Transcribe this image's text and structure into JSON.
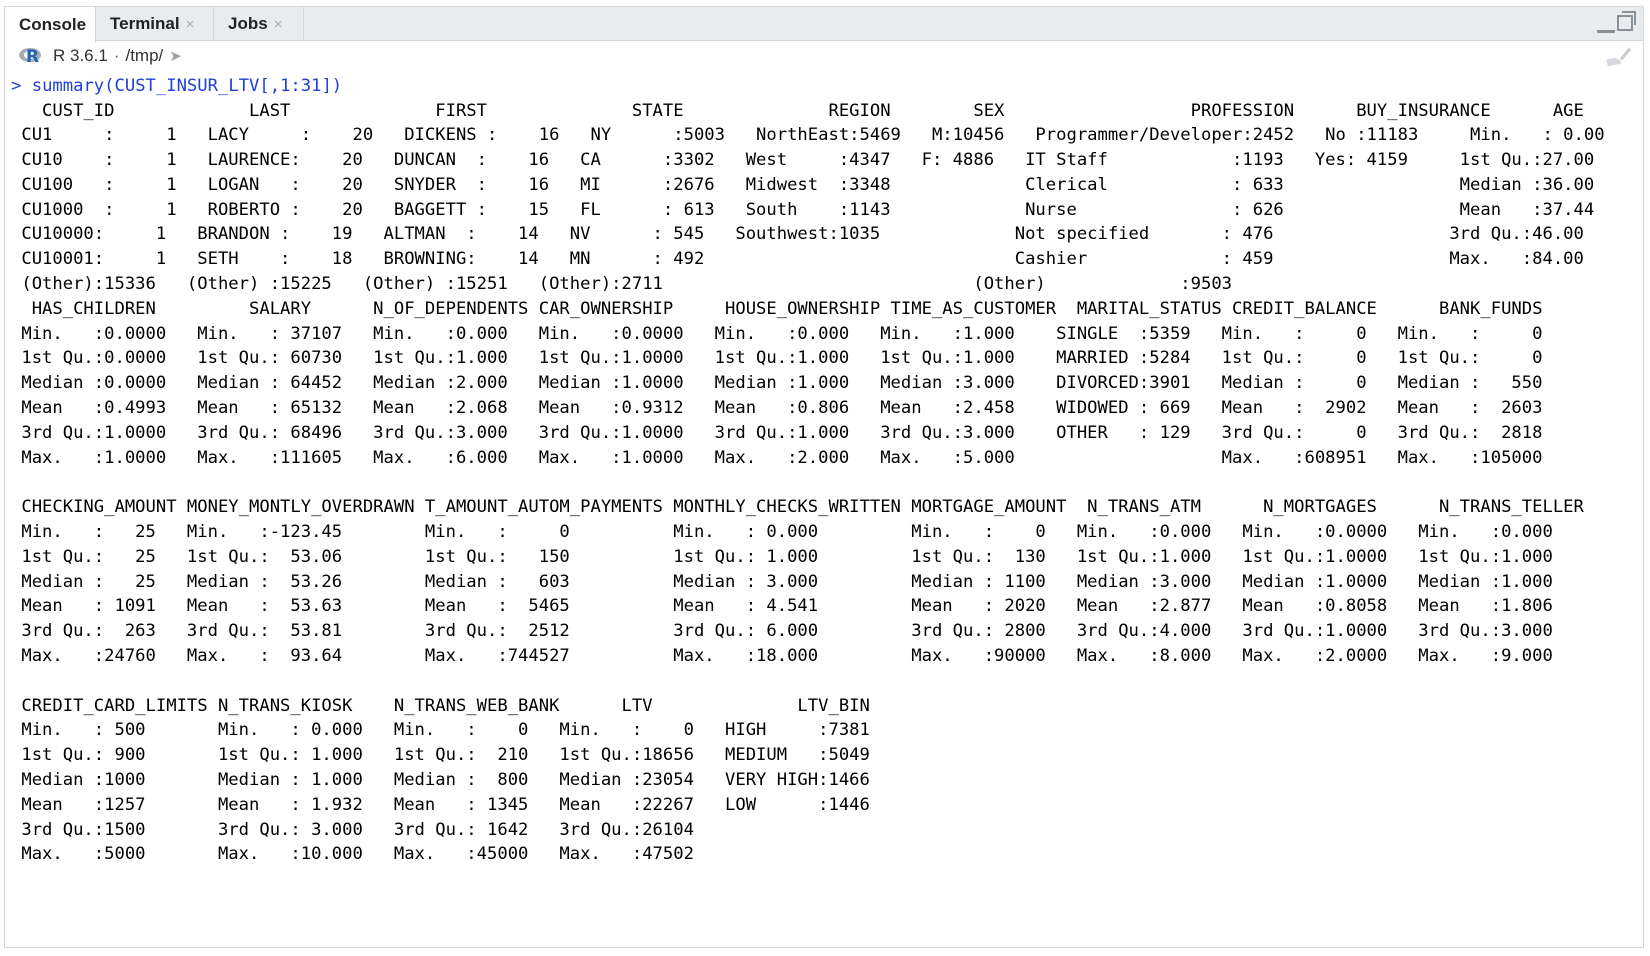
{
  "tabs": [
    {
      "label": "Console",
      "closable": false
    },
    {
      "label": "Terminal",
      "closable": true
    },
    {
      "label": "Jobs",
      "closable": true
    }
  ],
  "close_glyph": "×",
  "header": {
    "r_version": "R 3.6.1",
    "separator": "·",
    "path": "/tmp/"
  },
  "icons": {
    "r_logo": "r-logo-icon",
    "goto": "goto-directory-icon",
    "clear": "broom-icon",
    "minimize": "minimize-icon",
    "maximize": "maximize-icon"
  },
  "console": {
    "prompt": ">",
    "command": "summary(CUST_INSUR_LTV[,1:31])",
    "prompt_color": "#1f3fd6",
    "output": "   CUST_ID             LAST              FIRST              STATE              REGION        SEX                  PROFESSION      BUY_INSURANCE      AGE       \n CU1     :     1   LACY     :    20   DICKENS :    16   NY      :5003   NorthEast:5469   M:10456   Programmer/Developer:2452   No :11183     Min.   : 0.00  \n CU10    :     1   LAURENCE:    20   DUNCAN  :    16   CA      :3302   West     :4347   F: 4886   IT Staff            :1193   Yes: 4159     1st Qu.:27.00  \n CU100   :     1   LOGAN   :    20   SNYDER  :    16   MI      :2676   Midwest  :3348             Clerical            : 633                 Median :36.00  \n CU1000  :     1   ROBERTO :    20   BAGGETT :    15   FL      : 613   South    :1143             Nurse               : 626                 Mean   :37.44  \n CU10000:     1   BRANDON :    19   ALTMAN  :    14   NV      : 545   Southwest:1035             Not specified       : 476                 3rd Qu.:46.00  \n CU10001:     1   SETH    :    18   BROWNING:    14   MN      : 492                              Cashier             : 459                 Max.   :84.00  \n (Other):15336   (Other) :15225   (Other) :15251   (Other):2711                              (Other)             :9503                                  \n  HAS_CHILDREN         SALARY      N_OF_DEPENDENTS CAR_OWNERSHIP     HOUSE_OWNERSHIP TIME_AS_CUSTOMER  MARITAL_STATUS CREDIT_BALANCE      BANK_FUNDS     \n Min.   :0.0000   Min.   : 37107   Min.   :0.000   Min.   :0.0000   Min.   :0.000   Min.   :1.000    SINGLE  :5359   Min.   :     0   Min.   :     0  \n 1st Qu.:0.0000   1st Qu.: 60730   1st Qu.:1.000   1st Qu.:1.0000   1st Qu.:1.000   1st Qu.:1.000    MARRIED :5284   1st Qu.:     0   1st Qu.:     0  \n Median :0.0000   Median : 64452   Median :2.000   Median :1.0000   Median :1.000   Median :3.000    DIVORCED:3901   Median :     0   Median :   550  \n Mean   :0.4993   Mean   : 65132   Mean   :2.068   Mean   :0.9312   Mean   :0.806   Mean   :2.458    WIDOWED : 669   Mean   :  2902   Mean   :  2603  \n 3rd Qu.:1.0000   3rd Qu.: 68496   3rd Qu.:3.000   3rd Qu.:1.0000   3rd Qu.:1.000   3rd Qu.:3.000    OTHER   : 129   3rd Qu.:     0   3rd Qu.:  2818  \n Max.   :1.0000   Max.   :111605   Max.   :6.000   Max.   :1.0000   Max.   :2.000   Max.   :5.000                    Max.   :608951   Max.   :105000  \n                                                                                                                                                      \n CHECKING_AMOUNT MONEY_MONTLY_OVERDRAWN T_AMOUNT_AUTOM_PAYMENTS MONTHLY_CHECKS_WRITTEN MORTGAGE_AMOUNT  N_TRANS_ATM      N_MORTGAGES      N_TRANS_TELLER \n Min.   :   25   Min.   :-123.45        Min.   :     0          Min.   : 0.000         Min.   :    0   Min.   :0.000   Min.   :0.0000   Min.   :0.000  \n 1st Qu.:   25   1st Qu.:  53.06        1st Qu.:   150          1st Qu.: 1.000         1st Qu.:  130   1st Qu.:1.000   1st Qu.:1.0000   1st Qu.:1.000  \n Median :   25   Median :  53.26        Median :   603          Median : 3.000         Median : 1100   Median :3.000   Median :1.0000   Median :1.000  \n Mean   : 1091   Mean   :  53.63        Mean   :  5465          Mean   : 4.541         Mean   : 2020   Mean   :2.877   Mean   :0.8058   Mean   :1.806  \n 3rd Qu.:  263   3rd Qu.:  53.81        3rd Qu.:  2512          3rd Qu.: 6.000         3rd Qu.: 2800   3rd Qu.:4.000   3rd Qu.:1.0000   3rd Qu.:3.000  \n Max.   :24760   Max.   :  93.64        Max.   :744527          Max.   :18.000         Max.   :90000   Max.   :8.000   Max.   :2.0000   Max.   :9.000  \n                                                                                                                                                      \n CREDIT_CARD_LIMITS N_TRANS_KIOSK    N_TRANS_WEB_BANK      LTV              LTV_BIN    \n Min.   : 500       Min.   : 0.000   Min.   :    0   Min.   :    0   HIGH     :7381  \n 1st Qu.: 900       1st Qu.: 1.000   1st Qu.:  210   1st Qu.:18656   MEDIUM   :5049  \n Median :1000       Median : 1.000   Median :  800   Median :23054   VERY HIGH:1466  \n Mean   :1257       Mean   : 1.932   Mean   : 1345   Mean   :22267   LOW      :1446  \n 3rd Qu.:1500       3rd Qu.: 3.000   3rd Qu.: 1642   3rd Qu.:26104                  \n Max.   :5000       Max.   :10.000   Max.   :45000   Max.   :47502                  "
  }
}
